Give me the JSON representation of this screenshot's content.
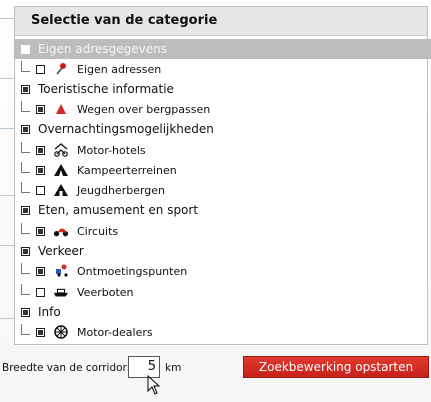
{
  "panel": {
    "title": "Selectie van de categorie",
    "categories": [
      {
        "label": "Eigen adresgegevens",
        "checked": false,
        "items": [
          {
            "label": "Eigen adressen",
            "checked": false,
            "icon": "pin-icon"
          }
        ]
      },
      {
        "label": "Toeristische informatie",
        "checked": true,
        "items": [
          {
            "label": "Wegen over bergpassen",
            "checked": true,
            "icon": "mountain-pass-icon"
          }
        ]
      },
      {
        "label": "Overnachtingsmogelijkheden",
        "checked": true,
        "items": [
          {
            "label": "Motor-hotels",
            "checked": true,
            "icon": "motor-hotel-icon"
          },
          {
            "label": "Kampeerterreinen",
            "checked": true,
            "icon": "tent-icon"
          },
          {
            "label": "Jeugdherbergen",
            "checked": false,
            "icon": "youth-hostel-icon"
          }
        ]
      },
      {
        "label": "Eten, amusement en sport",
        "checked": true,
        "items": [
          {
            "label": "Circuits",
            "checked": true,
            "icon": "motorcycle-icon"
          }
        ]
      },
      {
        "label": "Verkeer",
        "checked": true,
        "items": [
          {
            "label": "Ontmoetingspunten",
            "checked": true,
            "icon": "meeting-point-icon"
          },
          {
            "label": "Veerboten",
            "checked": false,
            "icon": "ferry-icon"
          }
        ]
      },
      {
        "label": "Info",
        "checked": true,
        "items": [
          {
            "label": "Motor-dealers",
            "checked": true,
            "icon": "wheel-icon"
          }
        ]
      }
    ]
  },
  "corridor": {
    "label": "Breedte van de corridor:",
    "value": "5",
    "unit": "km"
  },
  "search_button": {
    "label": "Zoekbewerking opstarten",
    "color": "#d42c22"
  },
  "colors": {
    "highlight_row": "#bdbdbd",
    "accent_red": "#d42c22"
  }
}
